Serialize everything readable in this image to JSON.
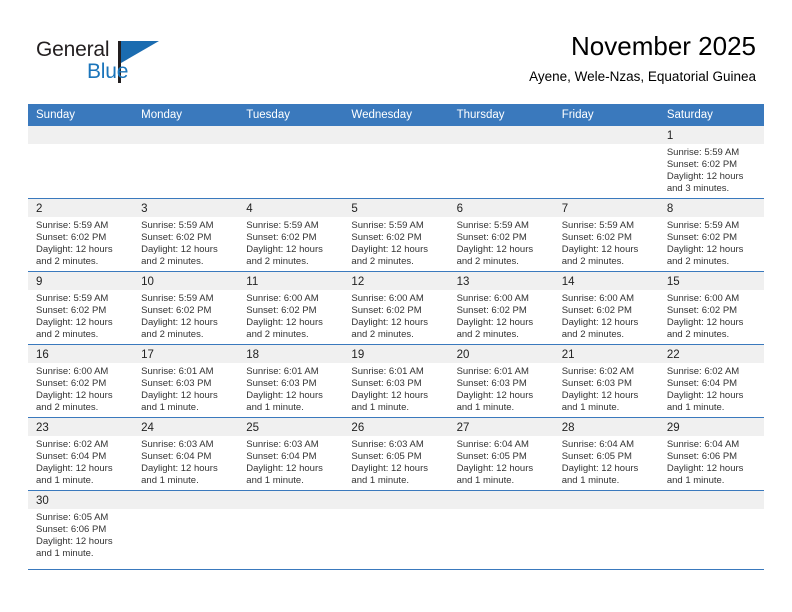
{
  "branding": {
    "logo_text_primary": "General",
    "logo_text_secondary": "Blue",
    "logo_icon": "triangle-flag-icon",
    "accent_color": "#1b6cb0"
  },
  "header": {
    "title": "November 2025",
    "subtitle": "Ayene, Wele-Nzas, Equatorial Guinea"
  },
  "colors": {
    "header_row_blue": "#3a79bd",
    "day_band_gray": "#f0f0f0",
    "logo_blue": "#1b75bb"
  },
  "weekday_headers": [
    "Sunday",
    "Monday",
    "Tuesday",
    "Wednesday",
    "Thursday",
    "Friday",
    "Saturday"
  ],
  "weeks": [
    [
      {
        "day": "",
        "sunrise": "",
        "sunset": "",
        "daylight_line1": "",
        "daylight_line2": ""
      },
      {
        "day": "",
        "sunrise": "",
        "sunset": "",
        "daylight_line1": "",
        "daylight_line2": ""
      },
      {
        "day": "",
        "sunrise": "",
        "sunset": "",
        "daylight_line1": "",
        "daylight_line2": ""
      },
      {
        "day": "",
        "sunrise": "",
        "sunset": "",
        "daylight_line1": "",
        "daylight_line2": ""
      },
      {
        "day": "",
        "sunrise": "",
        "sunset": "",
        "daylight_line1": "",
        "daylight_line2": ""
      },
      {
        "day": "",
        "sunrise": "",
        "sunset": "",
        "daylight_line1": "",
        "daylight_line2": ""
      },
      {
        "day": "1",
        "sunrise": "Sunrise: 5:59 AM",
        "sunset": "Sunset: 6:02 PM",
        "daylight_line1": "Daylight: 12 hours",
        "daylight_line2": "and 3 minutes."
      }
    ],
    [
      {
        "day": "2",
        "sunrise": "Sunrise: 5:59 AM",
        "sunset": "Sunset: 6:02 PM",
        "daylight_line1": "Daylight: 12 hours",
        "daylight_line2": "and 2 minutes."
      },
      {
        "day": "3",
        "sunrise": "Sunrise: 5:59 AM",
        "sunset": "Sunset: 6:02 PM",
        "daylight_line1": "Daylight: 12 hours",
        "daylight_line2": "and 2 minutes."
      },
      {
        "day": "4",
        "sunrise": "Sunrise: 5:59 AM",
        "sunset": "Sunset: 6:02 PM",
        "daylight_line1": "Daylight: 12 hours",
        "daylight_line2": "and 2 minutes."
      },
      {
        "day": "5",
        "sunrise": "Sunrise: 5:59 AM",
        "sunset": "Sunset: 6:02 PM",
        "daylight_line1": "Daylight: 12 hours",
        "daylight_line2": "and 2 minutes."
      },
      {
        "day": "6",
        "sunrise": "Sunrise: 5:59 AM",
        "sunset": "Sunset: 6:02 PM",
        "daylight_line1": "Daylight: 12 hours",
        "daylight_line2": "and 2 minutes."
      },
      {
        "day": "7",
        "sunrise": "Sunrise: 5:59 AM",
        "sunset": "Sunset: 6:02 PM",
        "daylight_line1": "Daylight: 12 hours",
        "daylight_line2": "and 2 minutes."
      },
      {
        "day": "8",
        "sunrise": "Sunrise: 5:59 AM",
        "sunset": "Sunset: 6:02 PM",
        "daylight_line1": "Daylight: 12 hours",
        "daylight_line2": "and 2 minutes."
      }
    ],
    [
      {
        "day": "9",
        "sunrise": "Sunrise: 5:59 AM",
        "sunset": "Sunset: 6:02 PM",
        "daylight_line1": "Daylight: 12 hours",
        "daylight_line2": "and 2 minutes."
      },
      {
        "day": "10",
        "sunrise": "Sunrise: 5:59 AM",
        "sunset": "Sunset: 6:02 PM",
        "daylight_line1": "Daylight: 12 hours",
        "daylight_line2": "and 2 minutes."
      },
      {
        "day": "11",
        "sunrise": "Sunrise: 6:00 AM",
        "sunset": "Sunset: 6:02 PM",
        "daylight_line1": "Daylight: 12 hours",
        "daylight_line2": "and 2 minutes."
      },
      {
        "day": "12",
        "sunrise": "Sunrise: 6:00 AM",
        "sunset": "Sunset: 6:02 PM",
        "daylight_line1": "Daylight: 12 hours",
        "daylight_line2": "and 2 minutes."
      },
      {
        "day": "13",
        "sunrise": "Sunrise: 6:00 AM",
        "sunset": "Sunset: 6:02 PM",
        "daylight_line1": "Daylight: 12 hours",
        "daylight_line2": "and 2 minutes."
      },
      {
        "day": "14",
        "sunrise": "Sunrise: 6:00 AM",
        "sunset": "Sunset: 6:02 PM",
        "daylight_line1": "Daylight: 12 hours",
        "daylight_line2": "and 2 minutes."
      },
      {
        "day": "15",
        "sunrise": "Sunrise: 6:00 AM",
        "sunset": "Sunset: 6:02 PM",
        "daylight_line1": "Daylight: 12 hours",
        "daylight_line2": "and 2 minutes."
      }
    ],
    [
      {
        "day": "16",
        "sunrise": "Sunrise: 6:00 AM",
        "sunset": "Sunset: 6:02 PM",
        "daylight_line1": "Daylight: 12 hours",
        "daylight_line2": "and 2 minutes."
      },
      {
        "day": "17",
        "sunrise": "Sunrise: 6:01 AM",
        "sunset": "Sunset: 6:03 PM",
        "daylight_line1": "Daylight: 12 hours",
        "daylight_line2": "and 1 minute."
      },
      {
        "day": "18",
        "sunrise": "Sunrise: 6:01 AM",
        "sunset": "Sunset: 6:03 PM",
        "daylight_line1": "Daylight: 12 hours",
        "daylight_line2": "and 1 minute."
      },
      {
        "day": "19",
        "sunrise": "Sunrise: 6:01 AM",
        "sunset": "Sunset: 6:03 PM",
        "daylight_line1": "Daylight: 12 hours",
        "daylight_line2": "and 1 minute."
      },
      {
        "day": "20",
        "sunrise": "Sunrise: 6:01 AM",
        "sunset": "Sunset: 6:03 PM",
        "daylight_line1": "Daylight: 12 hours",
        "daylight_line2": "and 1 minute."
      },
      {
        "day": "21",
        "sunrise": "Sunrise: 6:02 AM",
        "sunset": "Sunset: 6:03 PM",
        "daylight_line1": "Daylight: 12 hours",
        "daylight_line2": "and 1 minute."
      },
      {
        "day": "22",
        "sunrise": "Sunrise: 6:02 AM",
        "sunset": "Sunset: 6:04 PM",
        "daylight_line1": "Daylight: 12 hours",
        "daylight_line2": "and 1 minute."
      }
    ],
    [
      {
        "day": "23",
        "sunrise": "Sunrise: 6:02 AM",
        "sunset": "Sunset: 6:04 PM",
        "daylight_line1": "Daylight: 12 hours",
        "daylight_line2": "and 1 minute."
      },
      {
        "day": "24",
        "sunrise": "Sunrise: 6:03 AM",
        "sunset": "Sunset: 6:04 PM",
        "daylight_line1": "Daylight: 12 hours",
        "daylight_line2": "and 1 minute."
      },
      {
        "day": "25",
        "sunrise": "Sunrise: 6:03 AM",
        "sunset": "Sunset: 6:04 PM",
        "daylight_line1": "Daylight: 12 hours",
        "daylight_line2": "and 1 minute."
      },
      {
        "day": "26",
        "sunrise": "Sunrise: 6:03 AM",
        "sunset": "Sunset: 6:05 PM",
        "daylight_line1": "Daylight: 12 hours",
        "daylight_line2": "and 1 minute."
      },
      {
        "day": "27",
        "sunrise": "Sunrise: 6:04 AM",
        "sunset": "Sunset: 6:05 PM",
        "daylight_line1": "Daylight: 12 hours",
        "daylight_line2": "and 1 minute."
      },
      {
        "day": "28",
        "sunrise": "Sunrise: 6:04 AM",
        "sunset": "Sunset: 6:05 PM",
        "daylight_line1": "Daylight: 12 hours",
        "daylight_line2": "and 1 minute."
      },
      {
        "day": "29",
        "sunrise": "Sunrise: 6:04 AM",
        "sunset": "Sunset: 6:06 PM",
        "daylight_line1": "Daylight: 12 hours",
        "daylight_line2": "and 1 minute."
      }
    ],
    [
      {
        "day": "30",
        "sunrise": "Sunrise: 6:05 AM",
        "sunset": "Sunset: 6:06 PM",
        "daylight_line1": "Daylight: 12 hours",
        "daylight_line2": "and 1 minute."
      },
      {
        "day": "",
        "sunrise": "",
        "sunset": "",
        "daylight_line1": "",
        "daylight_line2": ""
      },
      {
        "day": "",
        "sunrise": "",
        "sunset": "",
        "daylight_line1": "",
        "daylight_line2": ""
      },
      {
        "day": "",
        "sunrise": "",
        "sunset": "",
        "daylight_line1": "",
        "daylight_line2": ""
      },
      {
        "day": "",
        "sunrise": "",
        "sunset": "",
        "daylight_line1": "",
        "daylight_line2": ""
      },
      {
        "day": "",
        "sunrise": "",
        "sunset": "",
        "daylight_line1": "",
        "daylight_line2": ""
      },
      {
        "day": "",
        "sunrise": "",
        "sunset": "",
        "daylight_line1": "",
        "daylight_line2": ""
      }
    ]
  ]
}
